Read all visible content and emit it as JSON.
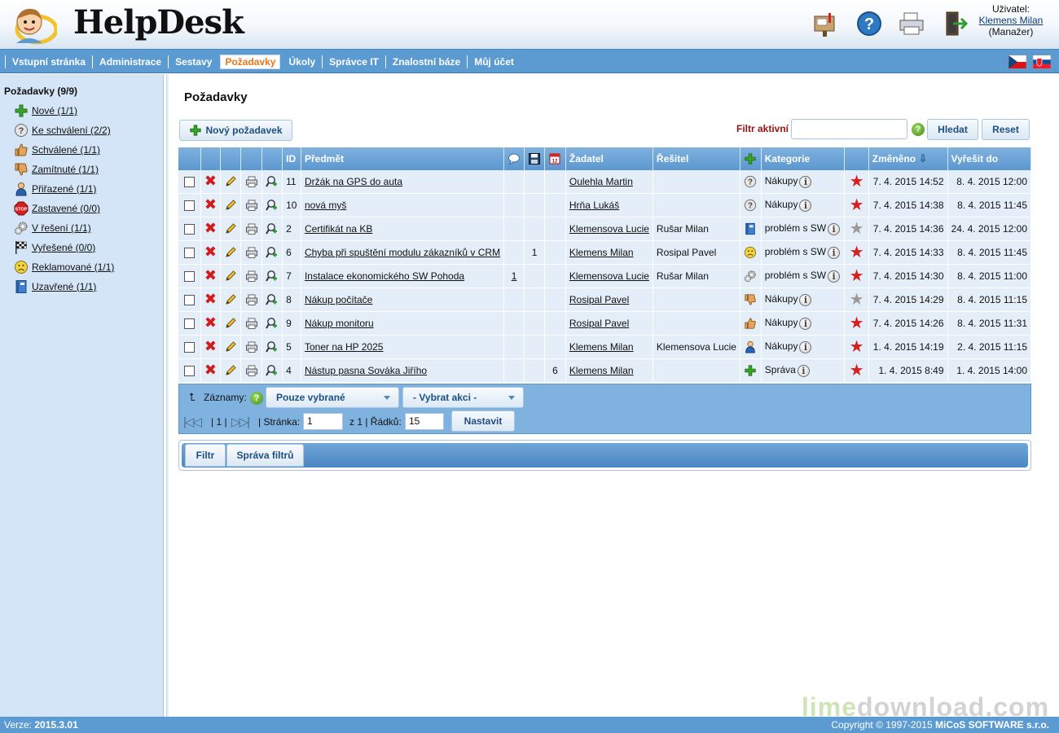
{
  "app": {
    "title": "HelpDesk"
  },
  "header": {
    "user_label": "Uživatel:",
    "user_name": "Klemens Milan",
    "user_role": "(Manažer)"
  },
  "nav": {
    "items": [
      "Vstupní stránka",
      "Administrace",
      "Sestavy",
      "Požadavky",
      "Úkoly",
      "Správce IT",
      "Znalostní báze",
      "Můj účet"
    ],
    "active": "Požadavky"
  },
  "sidebar": {
    "title": "Požadavky (9/9)",
    "items": [
      {
        "label": "Nové (1/1)",
        "icon": "plus-icon"
      },
      {
        "label": "Ke schválení (2/2)",
        "icon": "question-icon"
      },
      {
        "label": "Schválené (1/1)",
        "icon": "thumbs-up-icon"
      },
      {
        "label": "Zamítnuté (1/1)",
        "icon": "thumbs-down-icon"
      },
      {
        "label": "Přiřazené (1/1)",
        "icon": "person-icon"
      },
      {
        "label": "Zastavené (0/0)",
        "icon": "stop-icon"
      },
      {
        "label": "V řešení (1/1)",
        "icon": "gears-icon"
      },
      {
        "label": "Vyřešené (0/0)",
        "icon": "checkered-flag-icon"
      },
      {
        "label": "Reklamované (1/1)",
        "icon": "sad-face-icon"
      },
      {
        "label": "Uzavřené (1/1)",
        "icon": "binder-icon"
      }
    ]
  },
  "main": {
    "title": "Požadavky",
    "new_button": "Nový požadavek",
    "filter_label": "Filtr aktivní",
    "filter_value": "",
    "search_button": "Hledat",
    "reset_button": "Reset"
  },
  "table": {
    "headers": {
      "id": "ID",
      "subject": "Předmět",
      "requester": "Žadatel",
      "resolver": "Řešitel",
      "category": "Kategorie",
      "changed": "Změněno",
      "resolve_by": "Vyřešit do"
    },
    "rows": [
      {
        "id": "11",
        "subject": "Držák na GPS do auta",
        "c1": "",
        "c2": "",
        "c3": "",
        "requester": "Oulehla Martin",
        "resolver": "",
        "status_icon": "question-icon",
        "category": "Nákupy",
        "priority_color": "#d61f1f",
        "changed": "7. 4. 2015 14:52",
        "resolve_by": "8. 4. 2015 12:00"
      },
      {
        "id": "10",
        "subject": "nová myš",
        "c1": "",
        "c2": "",
        "c3": "",
        "requester": "Hrňa Lukáš",
        "resolver": "",
        "status_icon": "question-icon",
        "category": "Nákupy",
        "priority_color": "#d61f1f",
        "changed": "7. 4. 2015 14:38",
        "resolve_by": "8. 4. 2015 11:45"
      },
      {
        "id": "2",
        "subject": "Certifikát na KB",
        "c1": "",
        "c2": "",
        "c3": "",
        "requester": "Klemensova Lucie",
        "resolver": "Rušar Milan",
        "status_icon": "binder-icon",
        "category": "problém s SW",
        "priority_color": "#9a9a9a",
        "changed": "7. 4. 2015 14:36",
        "resolve_by": "24. 4. 2015 12:00"
      },
      {
        "id": "6",
        "subject": "Chyba při spuštění modulu zákazníků v CRM",
        "c1": "",
        "c2": "1",
        "c3": "",
        "requester": "Klemens Milan",
        "resolver": "Rosipal Pavel",
        "status_icon": "sad-face-icon",
        "category": "problém s SW",
        "priority_color": "#d61f1f",
        "changed": "7. 4. 2015 14:33",
        "resolve_by": "8. 4. 2015 11:45"
      },
      {
        "id": "7",
        "subject": "Instalace ekonomického SW Pohoda",
        "c1": "1",
        "c2": "",
        "c3": "",
        "requester": "Klemensova Lucie",
        "resolver": "Rušar Milan",
        "status_icon": "gears-icon",
        "category": "problém s SW",
        "priority_color": "#d61f1f",
        "changed": "7. 4. 2015 14:30",
        "resolve_by": "8. 4. 2015 11:00"
      },
      {
        "id": "8",
        "subject": "Nákup počítače",
        "c1": "",
        "c2": "",
        "c3": "",
        "requester": "Rosipal Pavel",
        "resolver": "",
        "status_icon": "thumbs-down-icon",
        "category": "Nákupy",
        "priority_color": "#9a9a9a",
        "changed": "7. 4. 2015 14:29",
        "resolve_by": "8. 4. 2015 11:15"
      },
      {
        "id": "9",
        "subject": "Nákup monitoru",
        "c1": "",
        "c2": "",
        "c3": "",
        "requester": "Rosipal Pavel",
        "resolver": "",
        "status_icon": "thumbs-up-icon",
        "category": "Nákupy",
        "priority_color": "#d61f1f",
        "changed": "7. 4. 2015 14:26",
        "resolve_by": "8. 4. 2015 11:31"
      },
      {
        "id": "5",
        "subject": "Toner na HP 2025",
        "c1": "",
        "c2": "",
        "c3": "",
        "requester": "Klemens Milan",
        "resolver": "Klemensova Lucie",
        "status_icon": "person-icon",
        "category": "Nákupy",
        "priority_color": "#d61f1f",
        "changed": "1. 4. 2015 14:19",
        "resolve_by": "2. 4. 2015 11:15"
      },
      {
        "id": "4",
        "subject": "Nástup pasna Sováka Jiřího",
        "c1": "",
        "c2": "",
        "c3": "6",
        "requester": "Klemens Milan",
        "resolver": "",
        "status_icon": "plus-icon",
        "category": "Správa",
        "priority_color": "#d61f1f",
        "changed": "1. 4. 2015 8:49",
        "resolve_by": "1. 4. 2015 14:00"
      }
    ]
  },
  "table_footer": {
    "records_label": "Záznamy:",
    "records_select": "Pouze vybrané",
    "action_select": "- Vybrat akci -",
    "pager_text": "| 1 |",
    "page_label": "| Stránka:",
    "page_value": "1",
    "of_label": "z 1 | Řádků:",
    "rows_value": "15",
    "apply_button": "Nastavit"
  },
  "tabs": [
    "Filtr",
    "Správa filtrů"
  ],
  "footer": {
    "version_label": "Verze:",
    "version": "2015.3.01",
    "copyright": "Copyright © 1997-2015",
    "company": "MiCoS SOFTWARE s.r.o."
  },
  "watermark": {
    "part1": "lime",
    "part2": "download.com"
  }
}
